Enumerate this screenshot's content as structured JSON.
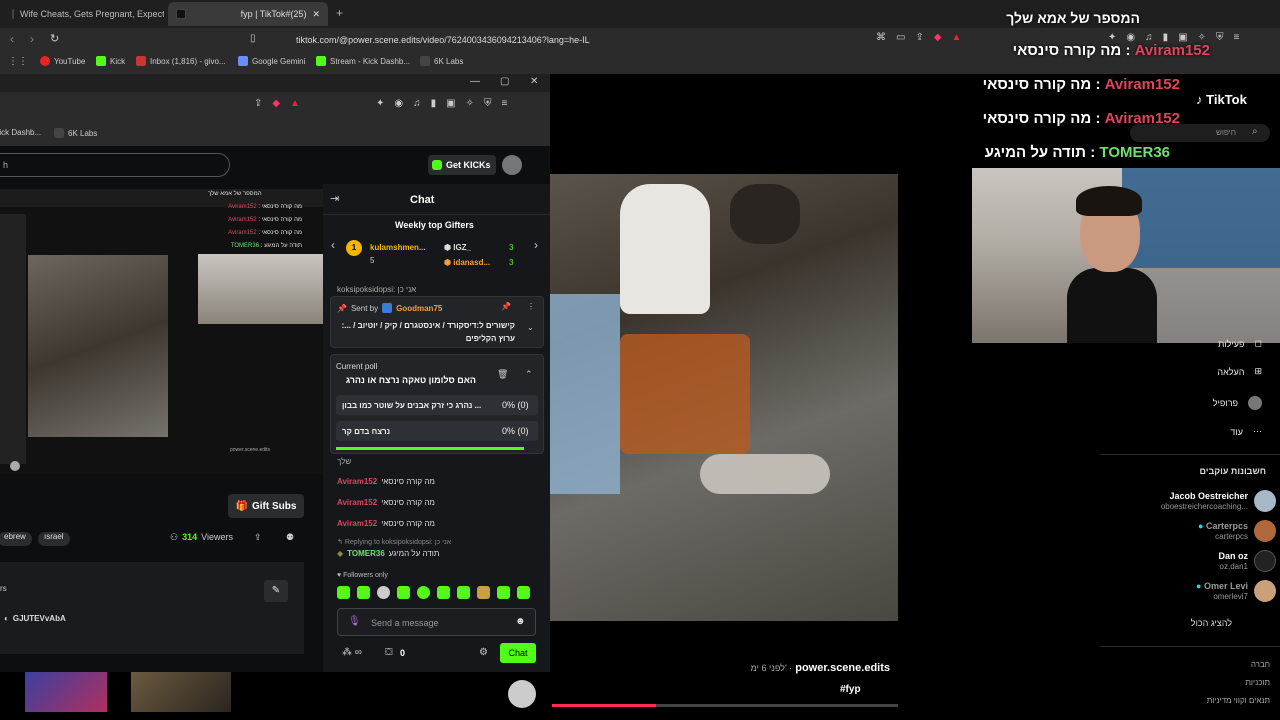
{
  "tabs": [
    {
      "title": "Wife Cheats, Gets Pregnant, Expects"
    },
    {
      "title": "fyp | TikTok#(25)"
    }
  ],
  "address": {
    "url": "tiktok.com/@power.scene.edits/video/7624003436094213406?lang=he-IL"
  },
  "bookmarks": [
    "YouTube",
    "Kick",
    "Inbox (1,816) - givo...",
    "Google Gemini",
    "Stream - Kick Dashb...",
    "6K Labs"
  ],
  "inner_bookmarks": [
    "Kick Dashb...",
    "6K Labs"
  ],
  "kick": {
    "get_kicks": "Get KICKs",
    "chat_title": "Chat",
    "weekly_top": "Weekly top Gifters",
    "gifters": [
      {
        "rank": "1",
        "name": "kulamshmen...",
        "amount": "5"
      },
      {
        "name": "IGZ_",
        "amount": "3"
      },
      {
        "name": "idanasd...",
        "amount": "3"
      }
    ],
    "pinned_user_line": "koksipoksidopsi: אני כן",
    "pinned_label": "Sent by",
    "pinned_by": "Goodman75",
    "pinned_text": "קישורים ל:דיסקורד / אינסטגרם / קיק / יוטיוב / ...: ערוץ הקליפים",
    "poll_label": "Current poll",
    "poll_question": "האם סלומון טאקה נרצח או נהרג",
    "poll_options": [
      {
        "text": "נהרג כי זרק אבנים על שוטר כמו בבון ...",
        "result": "0% (0)"
      },
      {
        "text": "נרצח בדם קר",
        "result": "0% (0)"
      }
    ],
    "messages": [
      {
        "user": "Aviram152",
        "text": "מה קורה סינסאי"
      },
      {
        "user": "Aviram152",
        "text": "מה קורה סינסאי"
      },
      {
        "user": "Aviram152",
        "text": "מה קורה סינסאי"
      }
    ],
    "reply_to": "Replying to koksipoksidopsi: אני כן",
    "reply_user": "TOMER36",
    "reply_text": "תודה על המיגע",
    "followers_only": "Followers only",
    "send_placeholder": "Send a message",
    "chat_button": "Chat",
    "gift_subs": "Gift Subs",
    "viewers": "314",
    "viewers_label": "Viewers",
    "tags": [
      "ebrew",
      "ısrael"
    ],
    "discord": "GJUTEVvAbA",
    "counter": "0",
    "partial_text": "שלך",
    "rs_label": "rs"
  },
  "overlay": {
    "top": "המספר של אמא שלך",
    "lines": [
      {
        "user": "Aviram152",
        "text": "מה קורה סינסאי :"
      },
      {
        "user": "Aviram152",
        "text": "מה קורה סינסאי :"
      },
      {
        "user": "Aviram152",
        "text": "מה קורה סינסאי :"
      },
      {
        "user": "TOMER36",
        "text": "תודה על המיגע :"
      }
    ]
  },
  "tiktok": {
    "logo": "TikTok",
    "search_placeholder": "חיפוש",
    "nav": [
      "פעילות",
      "העלאה",
      "פרופיל",
      "עוד"
    ],
    "following_title": "חשבונות עוקבים",
    "accounts": [
      {
        "name": "Jacob Oestreicher",
        "handle": "oboestreichercoaching..."
      },
      {
        "name": "Carterpcs",
        "handle": "carterpcs"
      },
      {
        "name": "Dan oz",
        "handle": "oz.dan1"
      },
      {
        "name": "Omer Levi",
        "handle": "omerlevi7"
      }
    ],
    "see_all": "להציג הכול",
    "author": "power.scene.edits",
    "time": "לפני 6 ימ' ·",
    "hashtag": "#fyp",
    "footer": [
      "חברה",
      "תוכניות",
      "תנאים וקווי מדיניות"
    ]
  }
}
